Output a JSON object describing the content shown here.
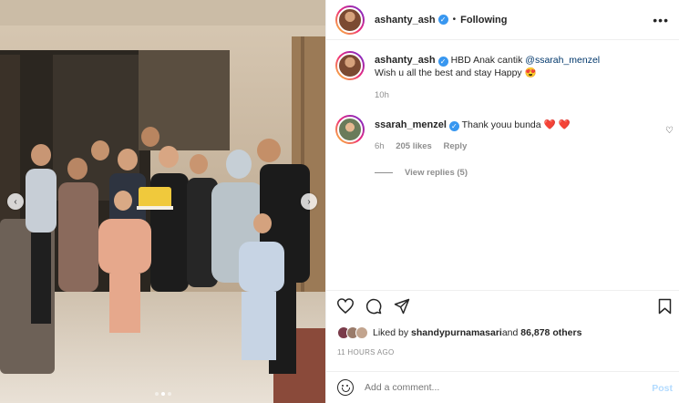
{
  "post": {
    "author": "ashanty_ash",
    "follow_sep": "•",
    "follow_label": "Following",
    "more_icon": "more-horizontal-icon"
  },
  "caption": {
    "username": "ashanty_ash",
    "text_before": "HBD Anak cantik ",
    "mention": "@ssarah_menzel",
    "line2": "Wish u all the best and stay Happy 😍",
    "time": "10h"
  },
  "reply": {
    "username": "ssarah_menzel",
    "text": "Thank youu bunda ❤️ ❤️",
    "time": "6h",
    "likes": "205 likes",
    "reply_label": "Reply",
    "view_replies": "View replies (5)"
  },
  "likes": {
    "prefix": "Liked by ",
    "user": "shandypurnamasari",
    "middle": " and ",
    "others": "86,878 others"
  },
  "timestamp": "11 HOURS AGO",
  "add_comment": {
    "placeholder": "Add a comment...",
    "post_label": "Post"
  },
  "colors": {
    "verified": "#3897f0",
    "post_button": "#b3dbff",
    "mention": "#00376b"
  }
}
